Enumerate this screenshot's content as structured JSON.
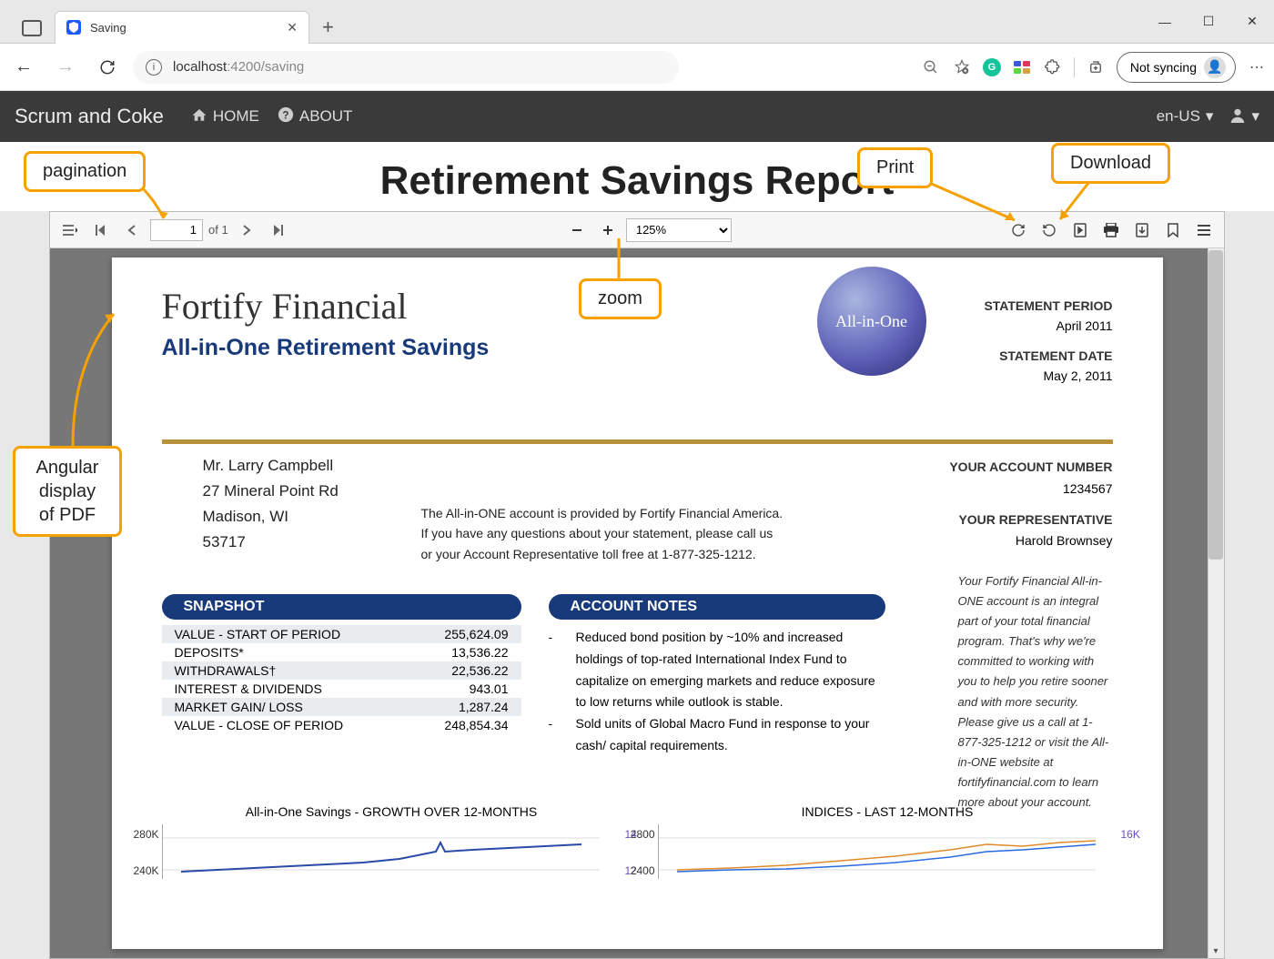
{
  "browser": {
    "tab_title": "Saving",
    "url_host": "localhost",
    "url_port": ":4200",
    "url_path": "/saving",
    "sync_label": "Not syncing"
  },
  "appnav": {
    "brand": "Scrum and Coke",
    "home": "HOME",
    "about": "ABOUT",
    "locale": "en-US"
  },
  "page_title": "Retirement Savings Report",
  "pdf_toolbar": {
    "page_current": "1",
    "page_total": "of 1",
    "zoom": "125%"
  },
  "document": {
    "company": "Fortify Financial",
    "product": "All-in-One Retirement Savings",
    "logo_text": "All-in-One",
    "stmt_period_label": "STATEMENT PERIOD",
    "stmt_period": "April 2011",
    "stmt_date_label": "STATEMENT DATE",
    "stmt_date": "May 2, 2011",
    "acct_num_label": "YOUR ACCOUNT NUMBER",
    "acct_num": "1234567",
    "rep_label": "YOUR REPRESENTATIVE",
    "rep_name": "Harold Brownsey",
    "recipient": {
      "name": "Mr. Larry Campbell",
      "addr1": "27 Mineral Point Rd",
      "addr2": "Madison, WI",
      "zip": "53717"
    },
    "desc": "The All-in-ONE account is provided by Fortify Financial America.  If you have any questions about your statement, please call us or your Account Representative toll free at 1-877-325-1212.",
    "side_note": "Your Fortify Financial All-in-ONE account is an integral part of your total financial program. That's why we're committed to working with you to help you retire sooner and with more security.  Please give us a call at 1-877-325-1212 or visit the All-in-ONE website at fortifyfinancial.com to learn more about your account.",
    "snapshot": {
      "header": "SNAPSHOT",
      "rows": [
        {
          "label": "VALUE - START OF PERIOD",
          "value": "255,624.09"
        },
        {
          "label": "DEPOSITS*",
          "value": "13,536.22"
        },
        {
          "label": "WITHDRAWALS†",
          "value": "22,536.22"
        },
        {
          "label": "INTEREST & DIVIDENDS",
          "value": "943.01"
        },
        {
          "label": "MARKET  GAIN/ LOSS",
          "value": "1,287.24"
        },
        {
          "label": "VALUE - CLOSE OF PERIOD",
          "value": "248,854.34"
        }
      ]
    },
    "notes": {
      "header": "ACCOUNT NOTES",
      "items": [
        "Reduced bond position by ~10% and increased holdings of top-rated International Index Fund to capitalize on emerging markets and reduce exposure to low returns while outlook is stable.",
        "Sold units of Global Macro Fund in response to your cash/ capital requirements."
      ]
    },
    "chart1_title": "All-in-One Savings - GROWTH OVER 12-MONTHS",
    "chart2_title": "INDICES - LAST 12-MONTHS",
    "chart1_y": [
      "280K",
      "240K"
    ],
    "chart1_y2": [
      "14",
      "12"
    ],
    "chart2_y": [
      "2800",
      "2400"
    ],
    "chart2_y2": [
      "16K"
    ]
  },
  "callouts": {
    "pagination": "pagination",
    "zoom": "zoom",
    "print": "Print",
    "download": "Download",
    "angular": "Angular display of PDF"
  }
}
